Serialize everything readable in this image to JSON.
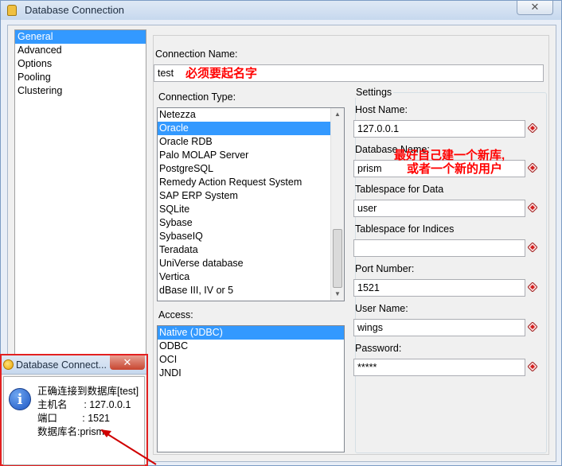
{
  "window": {
    "title": "Database Connection",
    "close_glyph": "✕"
  },
  "nav": {
    "items": [
      {
        "label": "General",
        "selected": true
      },
      {
        "label": "Advanced",
        "selected": false
      },
      {
        "label": "Options",
        "selected": false
      },
      {
        "label": "Pooling",
        "selected": false
      },
      {
        "label": "Clustering",
        "selected": false
      }
    ]
  },
  "general": {
    "connection_name_label": "Connection Name:",
    "connection_name_value": "test",
    "connection_name_note": "必须要起名字",
    "connection_type_label": "Connection Type:",
    "connection_types": [
      {
        "label": "Netezza",
        "selected": false
      },
      {
        "label": "Oracle",
        "selected": true
      },
      {
        "label": "Oracle RDB",
        "selected": false
      },
      {
        "label": "Palo MOLAP Server",
        "selected": false
      },
      {
        "label": "PostgreSQL",
        "selected": false
      },
      {
        "label": "Remedy Action Request System",
        "selected": false
      },
      {
        "label": "SAP ERP System",
        "selected": false
      },
      {
        "label": "SQLite",
        "selected": false
      },
      {
        "label": "Sybase",
        "selected": false
      },
      {
        "label": "SybaseIQ",
        "selected": false
      },
      {
        "label": "Teradata",
        "selected": false
      },
      {
        "label": "UniVerse database",
        "selected": false
      },
      {
        "label": "Vertica",
        "selected": false
      },
      {
        "label": "dBase III, IV or 5",
        "selected": false
      }
    ],
    "access_label": "Access:",
    "access_types": [
      {
        "label": "Native (JDBC)",
        "selected": true
      },
      {
        "label": "ODBC",
        "selected": false
      },
      {
        "label": "OCI",
        "selected": false
      },
      {
        "label": "JNDI",
        "selected": false
      }
    ]
  },
  "settings": {
    "legend": "Settings",
    "fields": [
      {
        "label": "Host Name:",
        "value": "127.0.0.1"
      },
      {
        "label": "Database Name:",
        "value": "prism"
      },
      {
        "label": "Tablespace for Data",
        "value": "user"
      },
      {
        "label": "Tablespace for Indices",
        "value": ""
      },
      {
        "label": "Port Number:",
        "value": "1521"
      },
      {
        "label": "User Name:",
        "value": "wings"
      },
      {
        "label": "Password:",
        "value": "*****"
      }
    ],
    "database_note_line1": "最好自己建一个新库,",
    "database_note_line2": "或者一个新的用户",
    "variable_icon": "variable-diamond-icon"
  },
  "popup": {
    "title": "Database Connect...",
    "close_glyph": "✕",
    "info_glyph": "i",
    "lines": [
      "正确连接到数据库[test]",
      "主机名      : 127.0.0.1",
      "端口         : 1521",
      "数据库名:prism"
    ]
  },
  "colors": {
    "selection": "#3399ff",
    "annotation": "#ff0000"
  }
}
